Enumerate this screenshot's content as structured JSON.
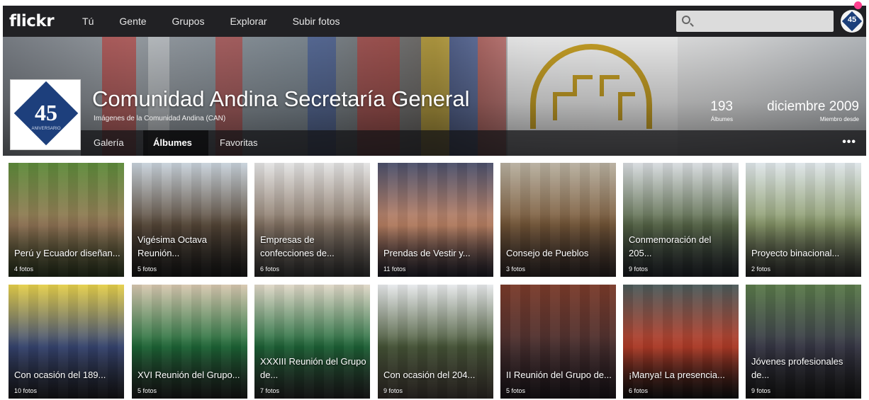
{
  "nav": {
    "logo": "flickr",
    "links": [
      "Tú",
      "Gente",
      "Grupos",
      "Explorar",
      "Subir fotos"
    ],
    "search_placeholder": "",
    "avatar_number": "45"
  },
  "profile": {
    "title": "Comunidad Andina Secretaría General",
    "subtitle": "Imágenes de la Comunidad Andina (CAN)",
    "avatar_number": "45",
    "avatar_caption": "ANIVERSARIO",
    "albums_count": "193",
    "albums_label": "Álbumes",
    "member_since": "diciembre 2009",
    "member_label": "Miembro desde",
    "tabs": [
      "Galería",
      "Álbumes",
      "Favoritas"
    ],
    "active_tab": "Álbumes",
    "more": "•••"
  },
  "albums": [
    {
      "title": "Perú y Ecuador diseñan...",
      "count": "4 fotos",
      "colors": [
        "#5d8a3a",
        "#9a7b5a",
        "#3a4a2a"
      ]
    },
    {
      "title": "Vigésima Octava Reunión...",
      "count": "5 fotos",
      "colors": [
        "#c9d3dc",
        "#5a4a3a",
        "#222"
      ]
    },
    {
      "title": "Empresas de confecciones de...",
      "count": "6 fotos",
      "colors": [
        "#e4e4e4",
        "#8a7868",
        "#444"
      ]
    },
    {
      "title": "Prendas de Vestir y...",
      "count": "11 fotos",
      "colors": [
        "#4a4f6a",
        "#c78a6a",
        "#2a2a3a"
      ]
    },
    {
      "title": "Consejo de Pueblos",
      "count": "3 fotos",
      "colors": [
        "#b8b0a0",
        "#7a5a3a",
        "#3a3030"
      ]
    },
    {
      "title": "Conmemoración del 205...",
      "count": "9 fotos",
      "colors": [
        "#d8dce0",
        "#5a6a4a",
        "#2a3038"
      ]
    },
    {
      "title": "Proyecto binacional...",
      "count": "2 fotos",
      "colors": [
        "#dfe6ea",
        "#8a9a6a",
        "#3a3a3a"
      ]
    },
    {
      "title": "Con ocasión del 189...",
      "count": "10 fotos",
      "colors": [
        "#e6d04a",
        "#3a4a7a",
        "#2a2a30"
      ]
    },
    {
      "title": "XVI Reunión del Grupo...",
      "count": "5 fotos",
      "colors": [
        "#d8c8b0",
        "#1f6e3a",
        "#2a2a2a"
      ]
    },
    {
      "title": "XXXIII Reunión del Grupo de...",
      "count": "7 fotos",
      "colors": [
        "#e0d8c8",
        "#1f6a3a",
        "#333"
      ]
    },
    {
      "title": "Con ocasión del 204...",
      "count": "9 fotos",
      "colors": [
        "#e8eaec",
        "#4a5a3a",
        "#5a5048"
      ]
    },
    {
      "title": "II Reunión del Grupo de...",
      "count": "5 fotos",
      "colors": [
        "#7a3a2a",
        "#4a3030",
        "#2a2028"
      ]
    },
    {
      "title": "¡Manya! La presencia...",
      "count": "6 fotos",
      "colors": [
        "#4a5a5a",
        "#c0402a",
        "#1a1a1a"
      ]
    },
    {
      "title": "Jóvenes profesionales de...",
      "count": "9 fotos",
      "colors": [
        "#5a7a4a",
        "#3a3a4a",
        "#222"
      ]
    }
  ]
}
